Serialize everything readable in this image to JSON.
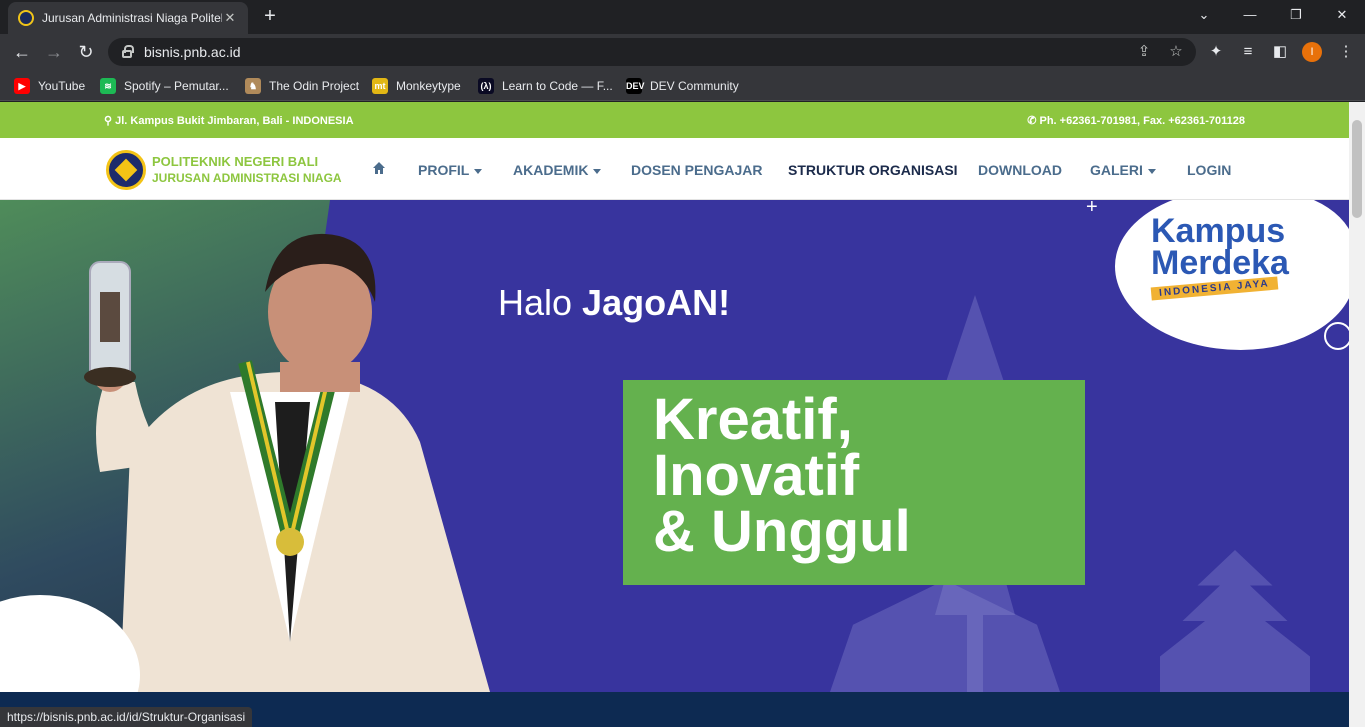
{
  "browser": {
    "tab_title": "Jurusan Administrasi Niaga Politeknik",
    "tab_close": "✕",
    "new_tab": "+",
    "url": "bisnis.pnb.ac.id",
    "avatar_letter": "I",
    "bookmarks": [
      {
        "label": "YouTube",
        "icon": "youtube-icon",
        "color": "#ff0000",
        "glyph": "▶"
      },
      {
        "label": "Spotify – Pemutar...",
        "icon": "spotify-icon",
        "color": "#1db954",
        "glyph": "≋"
      },
      {
        "label": "The Odin Project",
        "icon": "odin-icon",
        "color": "#b08a5a",
        "glyph": "♞"
      },
      {
        "label": "Monkeytype",
        "icon": "monkeytype-icon",
        "color": "#e2b714",
        "glyph": "mt"
      },
      {
        "label": "Learn to Code — F...",
        "icon": "freecodecamp-icon",
        "color": "#0a0a23",
        "glyph": "(λ)"
      },
      {
        "label": "DEV Community",
        "icon": "dev-icon",
        "color": "#000000",
        "glyph": "DEV"
      }
    ]
  },
  "site": {
    "top_address": "Jl. Kampus Bukit Jimbaran, Bali - INDONESIA",
    "top_phone": "Ph. +62361-701981, Fax. +62361-701128",
    "brand_line1": "POLITEKNIK NEGERI BALI",
    "brand_line2": "JURUSAN ADMINISTRASI NIAGA",
    "menu": [
      {
        "label": "PROFIL",
        "caret": true
      },
      {
        "label": "AKADEMIK",
        "caret": true
      },
      {
        "label": "DOSEN PENGAJAR",
        "caret": false
      },
      {
        "label": "STRUKTUR ORGANISASI",
        "caret": false,
        "active": true
      },
      {
        "label": "DOWNLOAD",
        "caret": false
      },
      {
        "label": "GALERI",
        "caret": true
      },
      {
        "label": "LOGIN",
        "caret": false
      }
    ],
    "hero": {
      "greeting_prefix": "Halo ",
      "greeting_name": "JagoAN!",
      "tagline_lines": [
        "Kreatif,",
        "Inovatif",
        "& Unggul"
      ],
      "badge_line1": "Kampus",
      "badge_line2": "Merdeka",
      "badge_line3": "INDONESIA JAYA"
    }
  },
  "status_url": "https://bisnis.pnb.ac.id/id/Struktur-Organisasi",
  "colors": {
    "accent_green": "#8dc63f",
    "hero_blue": "#38349e",
    "tagline_green": "#64b14e",
    "merdeka_blue": "#2b58b4"
  }
}
